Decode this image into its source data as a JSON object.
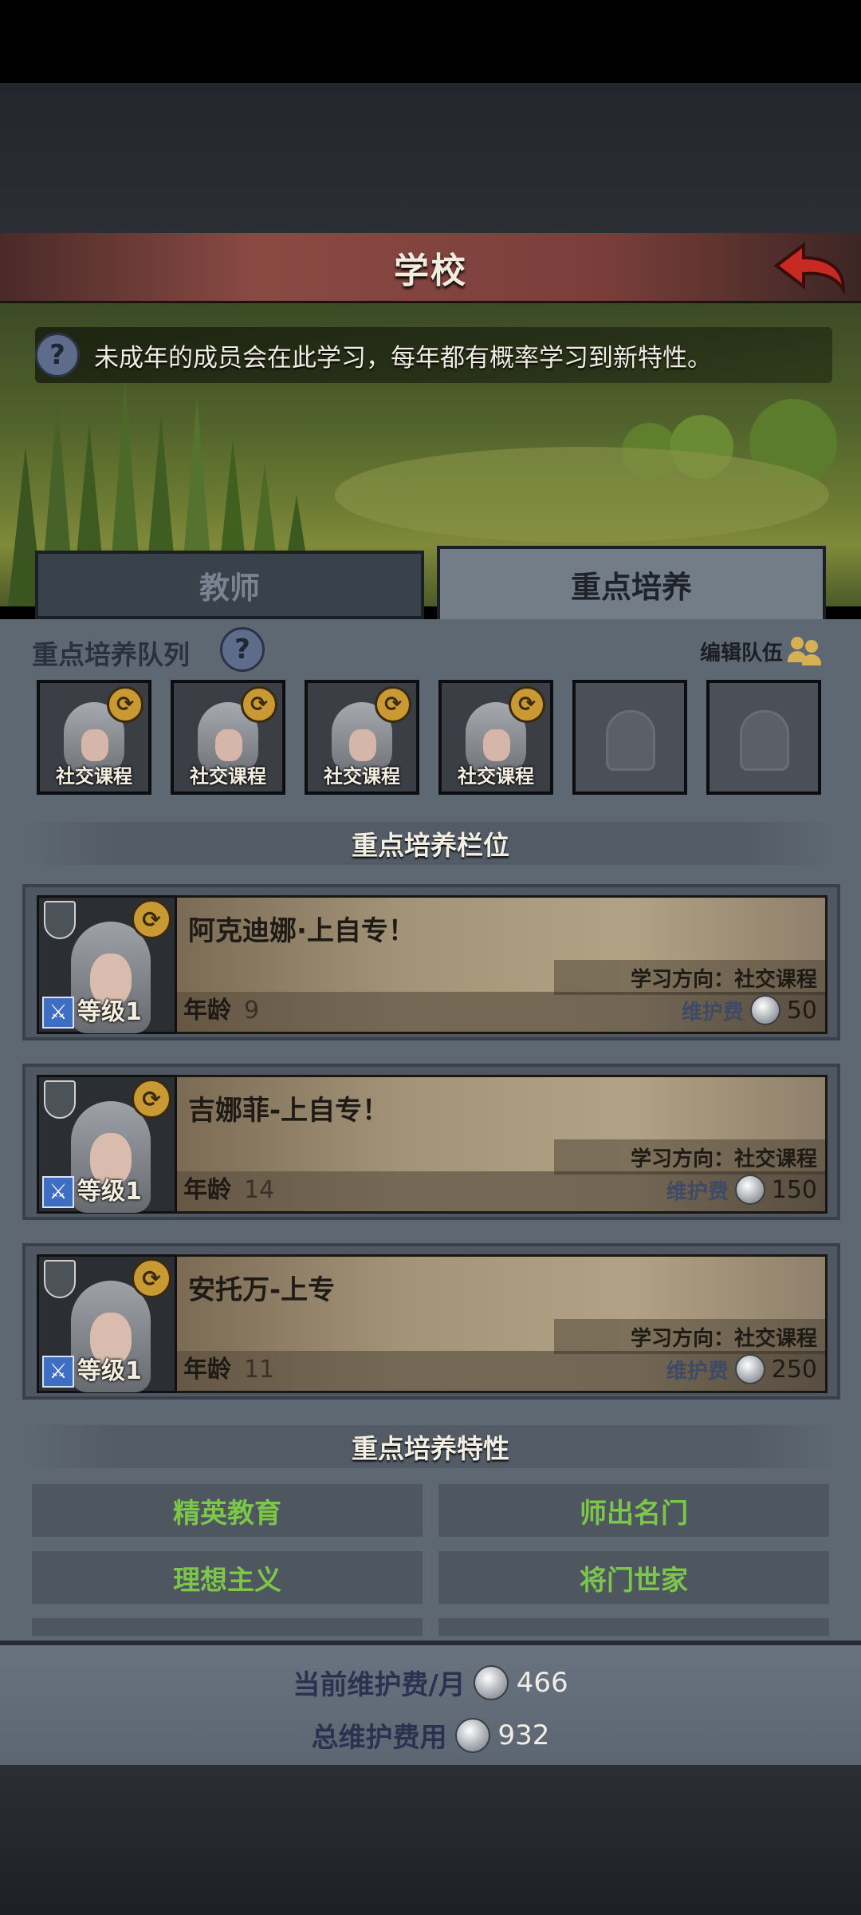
{
  "header": {
    "title": "学校",
    "back_icon": "back-arrow-icon"
  },
  "hint": {
    "text": "未成年的成员会在此学习，每年都有概率学习到新特性。",
    "icon": "question-icon"
  },
  "tabs": [
    {
      "label": "教师",
      "active": false
    },
    {
      "label": "重点培养",
      "active": true
    }
  ],
  "queue": {
    "title": "重点培养队列",
    "edit_label": "编辑队伍",
    "slots": [
      {
        "caption": "社交课程",
        "filled": true
      },
      {
        "caption": "社交课程",
        "filled": true
      },
      {
        "caption": "社交课程",
        "filled": true
      },
      {
        "caption": "社交课程",
        "filled": true
      },
      {
        "caption": "",
        "filled": false
      },
      {
        "caption": "",
        "filled": false
      }
    ]
  },
  "slots_section": {
    "title": "重点培养栏位",
    "cards": [
      {
        "name": "阿克迪娜·上自专！",
        "level": "等级1",
        "age_label": "年龄",
        "age": "9",
        "direction": "学习方向：社交课程",
        "fee_label": "维护费",
        "fee": "50"
      },
      {
        "name": "吉娜菲-上自专！",
        "level": "等级1",
        "age_label": "年龄",
        "age": "14",
        "direction": "学习方向：社交课程",
        "fee_label": "维护费",
        "fee": "150"
      },
      {
        "name": "安托万-上专",
        "level": "等级1",
        "age_label": "年龄",
        "age": "11",
        "direction": "学习方向：社交课程",
        "fee_label": "维护费",
        "fee": "250"
      }
    ]
  },
  "traits_section": {
    "title": "重点培养特性",
    "items": [
      "精英教育",
      "师出名门",
      "理想主义",
      "将门世家",
      "",
      ""
    ]
  },
  "footer": {
    "monthly_label": "当前维护费/月",
    "monthly_value": "466",
    "total_label": "总维护费用",
    "total_value": "932"
  },
  "colors": {
    "trait_text": "#7cc64a",
    "header_red": "#8a4a44",
    "accent_gold": "#c99a34"
  }
}
